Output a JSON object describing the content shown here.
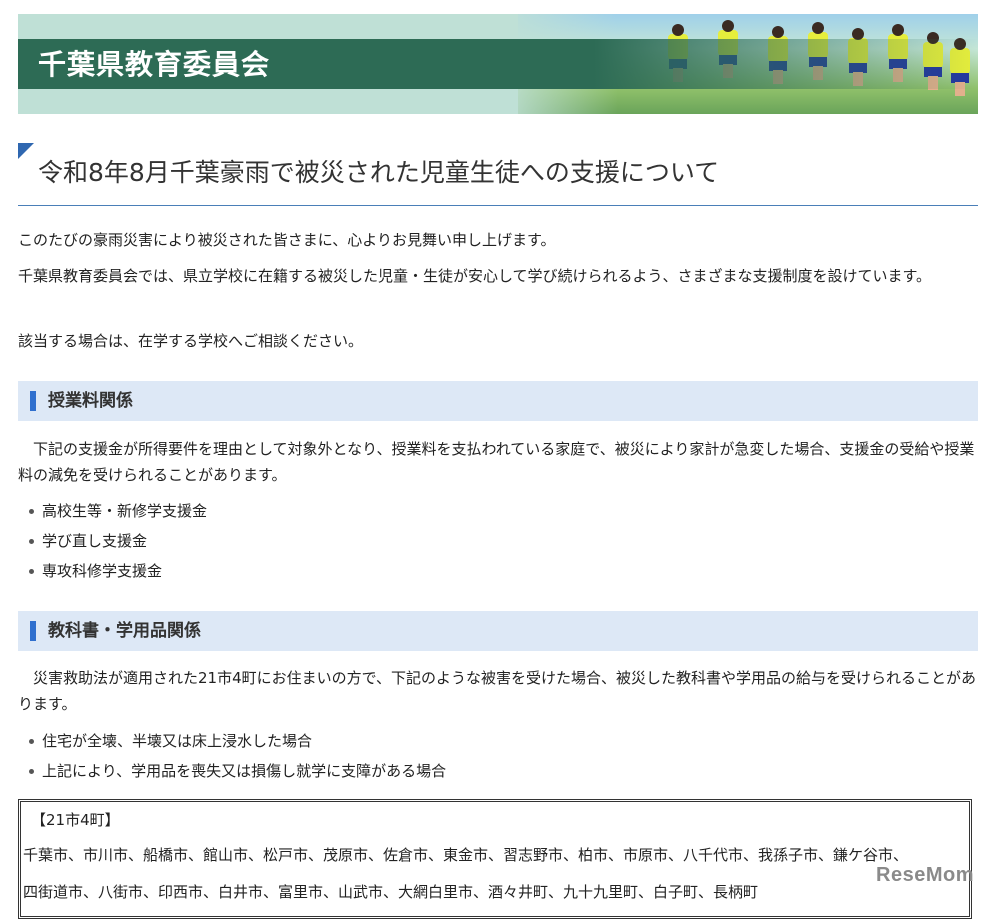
{
  "header": {
    "title": "千葉県教育委員会"
  },
  "page": {
    "title": "令和8年8月千葉豪雨で被災された児童生徒への支援について"
  },
  "intro": [
    "このたびの豪雨災害により被災された皆さまに、心よりお見舞い申し上げます。",
    "千葉県教育委員会では、県立学校に在籍する被災した児童・生徒が安心して学び続けられるよう、さまざまな支援制度を設けています。",
    "該当する場合は、在学する学校へご相談ください。"
  ],
  "sections": [
    {
      "heading": "授業料関係",
      "body": "　下記の支援金が所得要件を理由として対象外となり、授業料を支払われている家庭で、被災により家計が急変した場合、支援金の受給や授業料の減免を受けられることがあります。",
      "items": [
        "高校生等・新修学支援金",
        "学び直し支援金",
        "専攻科修学支援金"
      ]
    },
    {
      "heading": "教科書・学用品関係",
      "body": "　災害救助法が適用された21市4町にお住まいの方で、下記のような被害を受けた場合、被災した教科書や学用品の給与を受けられることがあります。",
      "items": [
        "住宅が全壊、半壊又は床上浸水した場合",
        "上記により、学用品を喪失又は損傷し就学に支障がある場合"
      ]
    }
  ],
  "box": {
    "heading": "【21市4町】",
    "line1": "千葉市、市川市、船橋市、館山市、松戸市、茂原市、佐倉市、東金市、習志野市、柏市、市原市、八千代市、我孫子市、鎌ケ谷市、",
    "line2": "四街道市、八街市、印西市、白井市、富里市、山武市、大網白里市、酒々井町、九十九里町、白子町、長柄町"
  },
  "watermark": "ReseMom",
  "colors": {
    "banner_bar": "#2d6b55",
    "title_rule": "#4a7fb8",
    "section_bg": "#dde8f6",
    "section_bar": "#2f6fce"
  }
}
